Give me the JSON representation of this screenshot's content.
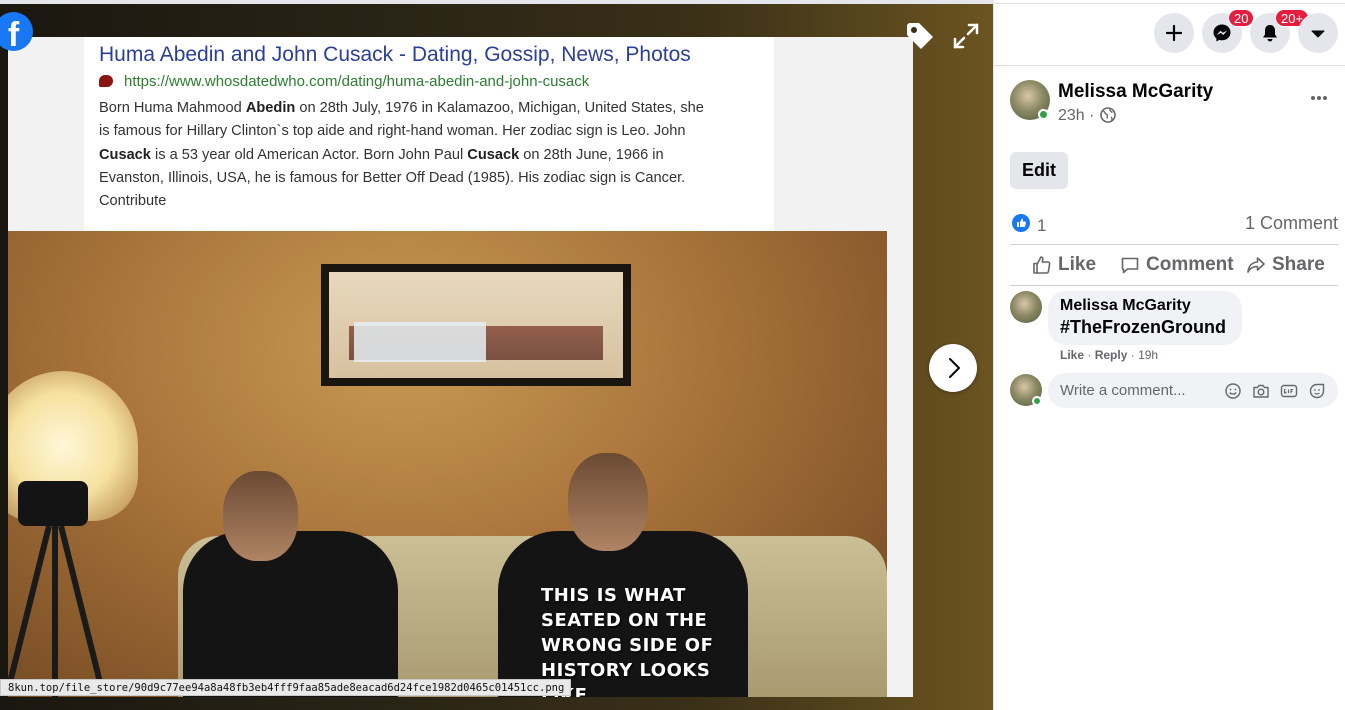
{
  "viewer": {
    "search_result": {
      "title": "Huma Abedin and John Cusack - Dating, Gossip, News, Photos",
      "url": "https://www.whosdatedwho.com/dating/huma-abedin-and-john-cusack",
      "snippet_lines": [
        [
          "Born Huma Mahmood ",
          "Abedin",
          " on 28th July, 1976 in Kalamazoo, Michigan, United States, she"
        ],
        [
          "is famous for Hillary Clinton`s top aide and right-hand woman. Her zodiac sign is Leo. John"
        ],
        [
          "",
          "Cusack",
          " is a 53 year old American Actor. Born John Paul ",
          "Cusack",
          " on 28th June, 1966 in"
        ],
        [
          "Evanston, Illinois, USA, he is famous for Better Off Dead (1985). His zodiac sign is Cancer."
        ],
        [
          "Contribute"
        ]
      ]
    },
    "meme_caption": [
      "THIS IS WHAT",
      "SEATED ON THE",
      "WRONG SIDE OF",
      "HISTORY LOOKS",
      "LIKE"
    ],
    "status_url": "8kun.top/file_store/90d9c77ee94a8a48fb3eb4fff9faa85ade8eacad6d24fce1982d0465c01451cc.png",
    "logo_letter": "f",
    "icons": {
      "logo": "facebook-logo-icon",
      "tag": "tag-icon",
      "expand": "fullscreen-icon",
      "next": "chevron-right-icon"
    }
  },
  "header": {
    "badges": {
      "messenger": "20",
      "notifications": "20+"
    },
    "icons": [
      "plus-icon",
      "messenger-icon",
      "bell-icon",
      "caret-down-icon"
    ]
  },
  "post": {
    "author": "Melissa McGarity",
    "time": "23h ·",
    "edit_label": "Edit",
    "like_count": "1",
    "comment_count": "1 Comment",
    "actions": {
      "like": "Like",
      "comment": "Comment",
      "share": "Share"
    }
  },
  "comment": {
    "author": "Melissa McGarity",
    "text": "#TheFrozenGround",
    "like": "Like",
    "reply": "Reply",
    "time": "19h"
  },
  "composer": {
    "placeholder": "Write a comment..."
  },
  "colors": {
    "brand": "#1877f2",
    "badge": "#e41e3f",
    "online": "#31a24c"
  }
}
